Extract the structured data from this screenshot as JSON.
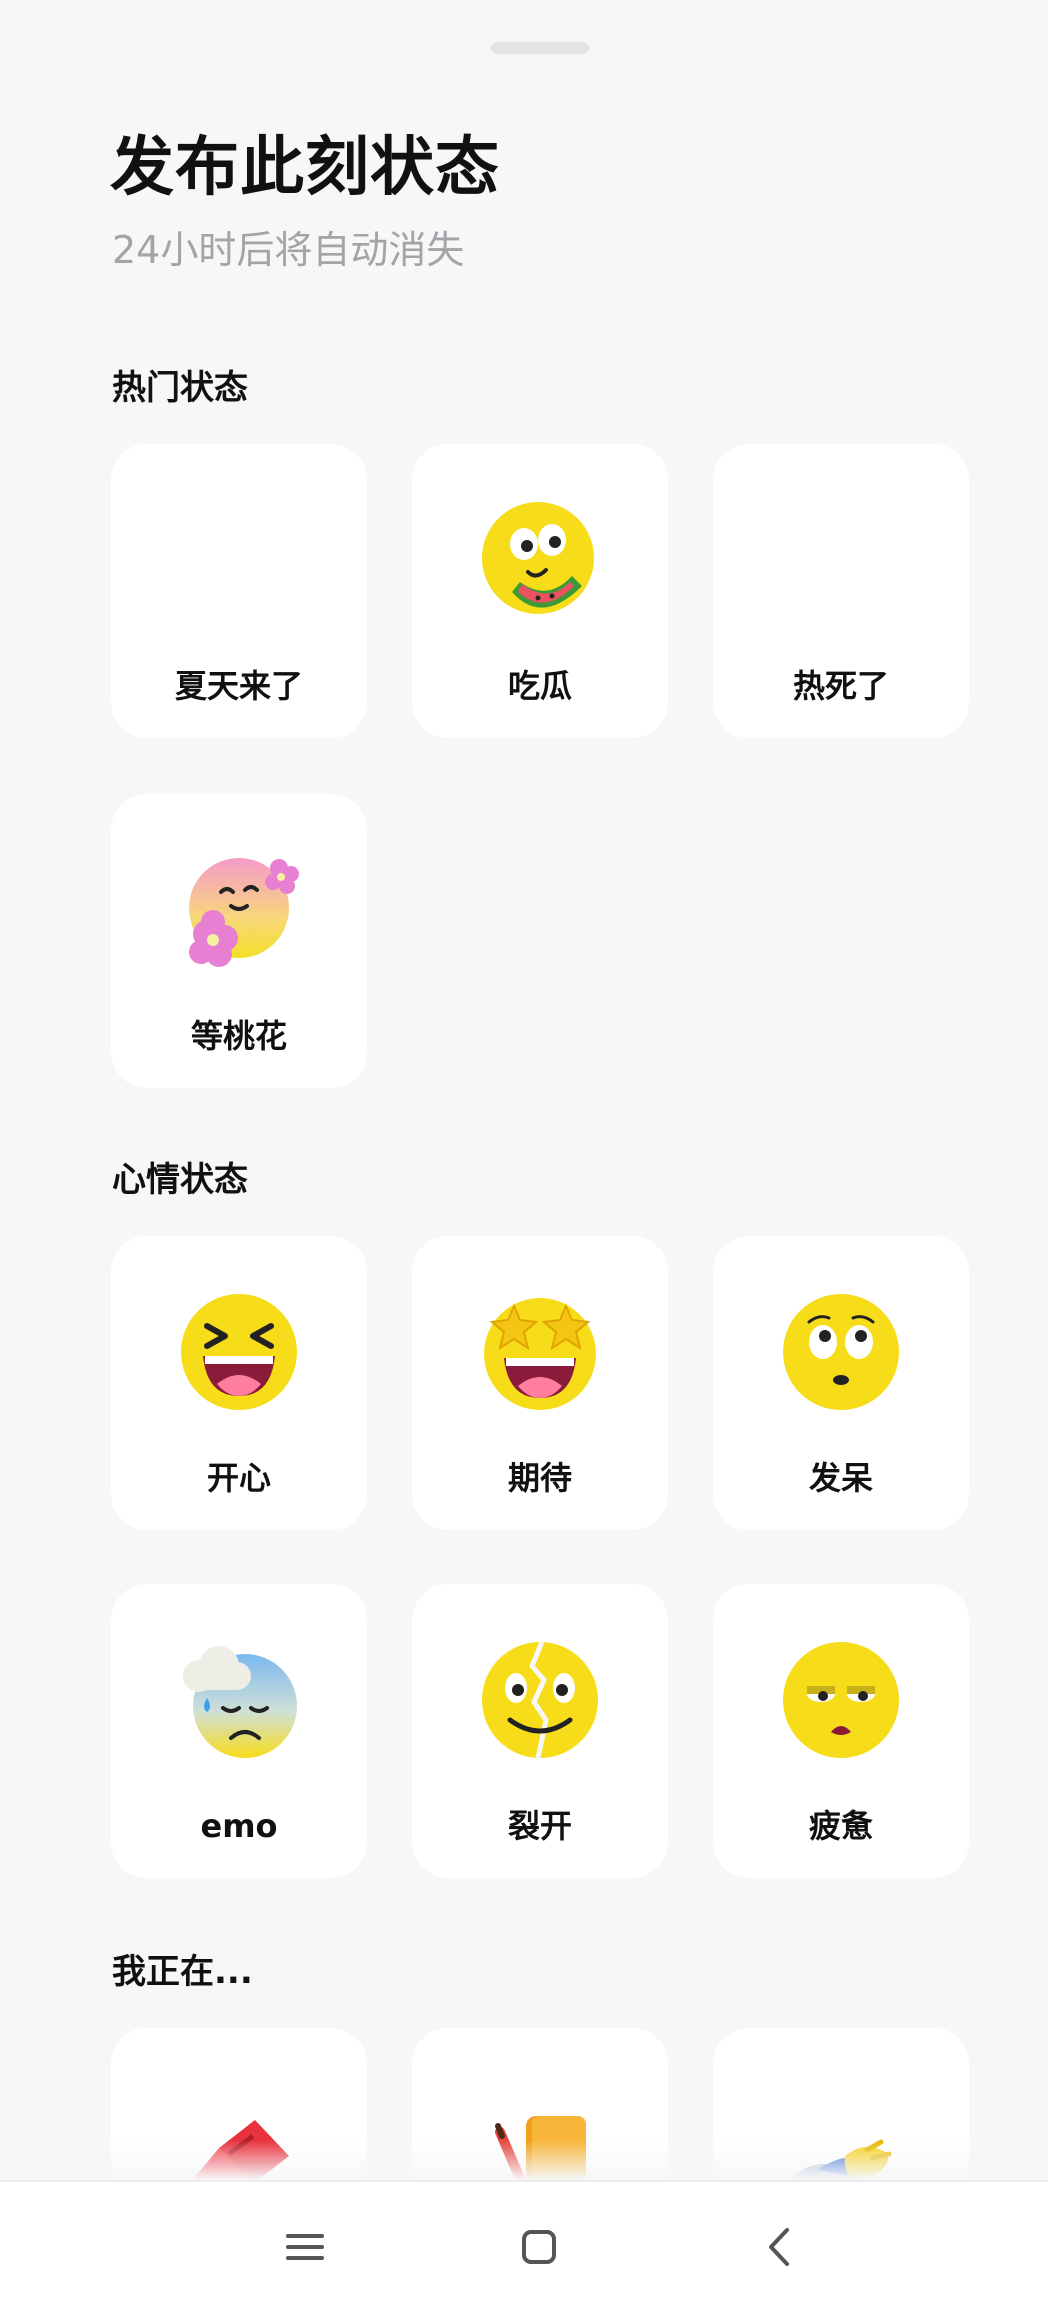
{
  "header": {
    "title": "发布此刻状态",
    "subtitle": "24小时后将自动消失"
  },
  "sections": {
    "hot": {
      "title": "热门状态",
      "items": [
        {
          "label": "夏天来了",
          "icon": "none"
        },
        {
          "label": "吃瓜",
          "icon": "watermelon-face-icon"
        },
        {
          "label": "热死了",
          "icon": "none"
        },
        {
          "label": "等桃花",
          "icon": "peach-blossom-face-icon"
        }
      ]
    },
    "mood": {
      "title": "心情状态",
      "items": [
        {
          "label": "开心",
          "icon": "laughing-face-icon"
        },
        {
          "label": "期待",
          "icon": "star-eyes-face-icon"
        },
        {
          "label": "发呆",
          "icon": "blank-stare-face-icon"
        },
        {
          "label": "emo",
          "icon": "cloud-sad-face-icon"
        },
        {
          "label": "裂开",
          "icon": "cracked-face-icon"
        },
        {
          "label": "疲惫",
          "icon": "tired-face-icon"
        }
      ]
    },
    "doing": {
      "title": "我正在...",
      "items": [
        {
          "label": "",
          "icon": "red-laptop-icon"
        },
        {
          "label": "",
          "icon": "notebook-pencil-icon"
        },
        {
          "label": "",
          "icon": "fish-glove-icon"
        }
      ]
    }
  },
  "navbar": {
    "menu_icon": "menu-icon",
    "home_icon": "home-square-icon",
    "back_icon": "back-chevron-icon"
  },
  "colors": {
    "background": "#f7f7f8",
    "card": "#ffffff",
    "emoji_yellow": "#f7dc1a",
    "subtitle": "#a3a3a8"
  }
}
